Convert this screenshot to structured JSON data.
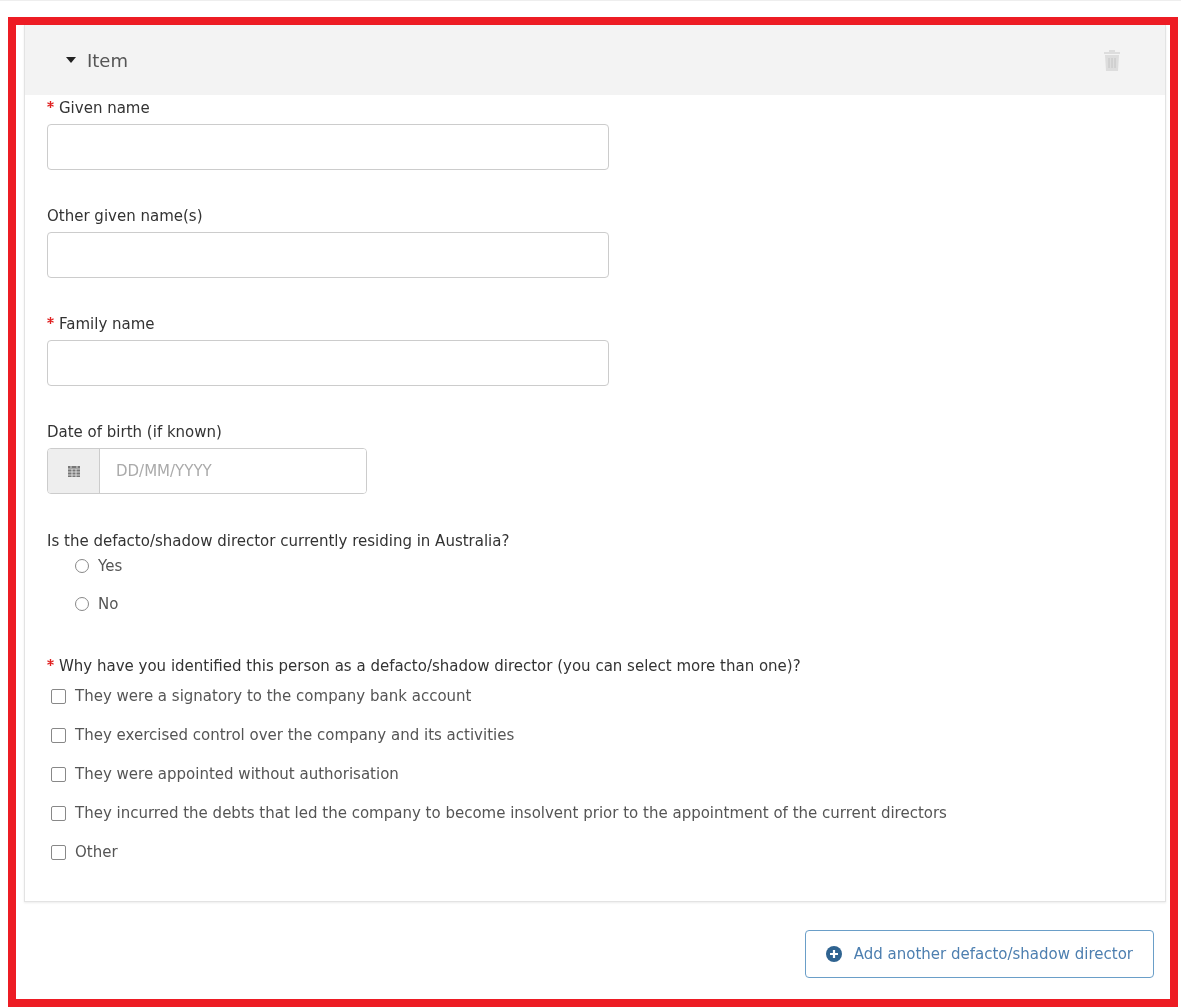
{
  "item": {
    "title": "Item",
    "expanded": true
  },
  "fields": [
    {
      "kind": "text",
      "label": "Given name",
      "required": true
    },
    {
      "kind": "text",
      "label": "Other given name(s)",
      "required": false
    },
    {
      "kind": "text",
      "label": "Family name",
      "required": true
    },
    {
      "kind": "date",
      "label": "Date of birth (if known)",
      "required": false,
      "placeholder": "DD/MM/YYYY"
    }
  ],
  "residing": {
    "question": "Is the defacto/shadow director currently residing in Australia?",
    "required": false,
    "options": [
      {
        "label": "Yes",
        "selected": false
      },
      {
        "label": "No",
        "selected": false
      }
    ]
  },
  "reasons": {
    "question": "Why have you identified this person as a defacto/shadow director (you can select more than one)?",
    "required": true,
    "options": [
      {
        "label": "They were a signatory to the company bank account",
        "checked": false
      },
      {
        "label": "They exercised control over the company and its activities",
        "checked": false
      },
      {
        "label": "They were appointed without authorisation",
        "checked": false
      },
      {
        "label": "They incurred the debts that led the company to become insolvent prior to the appointment of the current directors",
        "checked": false
      },
      {
        "label": "Other",
        "checked": false
      }
    ]
  },
  "add_button": "Add another defacto/shadow director"
}
